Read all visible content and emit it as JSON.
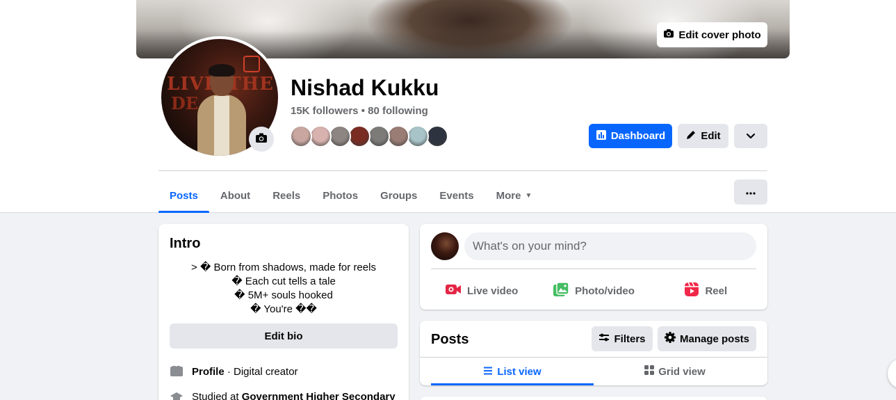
{
  "cover": {
    "edit_label": "Edit cover photo"
  },
  "profile": {
    "name": "Nishad Kukku",
    "followers_text": "15K followers • 80 following",
    "avatar_text_left": "LIVIN",
    "avatar_text_right": "THE",
    "avatar_text_bottom": "DE",
    "friend_avatar_colors": [
      "#c9a7a0",
      "#d8b2ae",
      "#8c8582",
      "#7a2c22",
      "#7d7b78",
      "#9a7d74",
      "#a8c4c9",
      "#2d3440"
    ]
  },
  "actions": {
    "dashboard_label": "Dashboard",
    "edit_label": "Edit"
  },
  "tabs": [
    {
      "label": "Posts",
      "active": true
    },
    {
      "label": "About"
    },
    {
      "label": "Reels"
    },
    {
      "label": "Photos"
    },
    {
      "label": "Groups"
    },
    {
      "label": "Events"
    },
    {
      "label": "More"
    }
  ],
  "intro": {
    "title": "Intro",
    "bio_lines": [
      "> � Born from shadows, made for reels",
      "� Each cut tells a tale",
      "� 5M+ souls hooked",
      "� You're ��"
    ],
    "edit_bio_label": "Edit bio",
    "profile_label": "Profile",
    "profile_value": " · Digital creator",
    "studied_prefix": "Studied at ",
    "studied_school": "Government Higher Secondary"
  },
  "composer": {
    "placeholder": "What's on your mind?",
    "live_label": "Live video",
    "photo_label": "Photo/video",
    "reel_label": "Reel"
  },
  "posts": {
    "title": "Posts",
    "filters_label": "Filters",
    "manage_label": "Manage posts",
    "list_view_label": "List view",
    "grid_view_label": "Grid view"
  },
  "colors": {
    "accent": "#0866ff",
    "live_red": "#e42645",
    "photo_green": "#45bd62",
    "reel_pink": "#f02849"
  }
}
